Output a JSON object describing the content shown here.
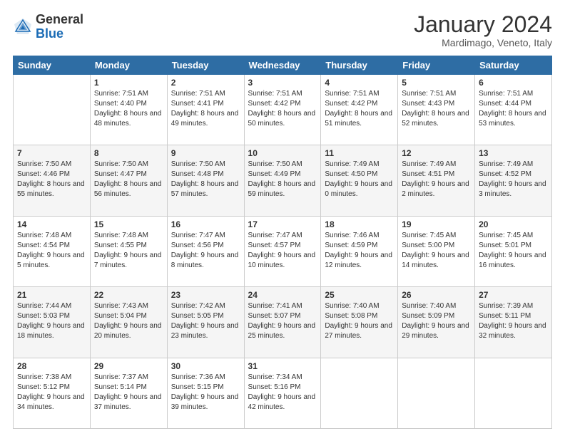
{
  "logo": {
    "general": "General",
    "blue": "Blue"
  },
  "header": {
    "month": "January 2024",
    "location": "Mardimago, Veneto, Italy"
  },
  "days_of_week": [
    "Sunday",
    "Monday",
    "Tuesday",
    "Wednesday",
    "Thursday",
    "Friday",
    "Saturday"
  ],
  "weeks": [
    [
      {
        "day": "",
        "sunrise": "",
        "sunset": "",
        "daylight": ""
      },
      {
        "day": "1",
        "sunrise": "Sunrise: 7:51 AM",
        "sunset": "Sunset: 4:40 PM",
        "daylight": "Daylight: 8 hours and 48 minutes."
      },
      {
        "day": "2",
        "sunrise": "Sunrise: 7:51 AM",
        "sunset": "Sunset: 4:41 PM",
        "daylight": "Daylight: 8 hours and 49 minutes."
      },
      {
        "day": "3",
        "sunrise": "Sunrise: 7:51 AM",
        "sunset": "Sunset: 4:42 PM",
        "daylight": "Daylight: 8 hours and 50 minutes."
      },
      {
        "day": "4",
        "sunrise": "Sunrise: 7:51 AM",
        "sunset": "Sunset: 4:42 PM",
        "daylight": "Daylight: 8 hours and 51 minutes."
      },
      {
        "day": "5",
        "sunrise": "Sunrise: 7:51 AM",
        "sunset": "Sunset: 4:43 PM",
        "daylight": "Daylight: 8 hours and 52 minutes."
      },
      {
        "day": "6",
        "sunrise": "Sunrise: 7:51 AM",
        "sunset": "Sunset: 4:44 PM",
        "daylight": "Daylight: 8 hours and 53 minutes."
      }
    ],
    [
      {
        "day": "7",
        "sunrise": "Sunrise: 7:50 AM",
        "sunset": "Sunset: 4:46 PM",
        "daylight": "Daylight: 8 hours and 55 minutes."
      },
      {
        "day": "8",
        "sunrise": "Sunrise: 7:50 AM",
        "sunset": "Sunset: 4:47 PM",
        "daylight": "Daylight: 8 hours and 56 minutes."
      },
      {
        "day": "9",
        "sunrise": "Sunrise: 7:50 AM",
        "sunset": "Sunset: 4:48 PM",
        "daylight": "Daylight: 8 hours and 57 minutes."
      },
      {
        "day": "10",
        "sunrise": "Sunrise: 7:50 AM",
        "sunset": "Sunset: 4:49 PM",
        "daylight": "Daylight: 8 hours and 59 minutes."
      },
      {
        "day": "11",
        "sunrise": "Sunrise: 7:49 AM",
        "sunset": "Sunset: 4:50 PM",
        "daylight": "Daylight: 9 hours and 0 minutes."
      },
      {
        "day": "12",
        "sunrise": "Sunrise: 7:49 AM",
        "sunset": "Sunset: 4:51 PM",
        "daylight": "Daylight: 9 hours and 2 minutes."
      },
      {
        "day": "13",
        "sunrise": "Sunrise: 7:49 AM",
        "sunset": "Sunset: 4:52 PM",
        "daylight": "Daylight: 9 hours and 3 minutes."
      }
    ],
    [
      {
        "day": "14",
        "sunrise": "Sunrise: 7:48 AM",
        "sunset": "Sunset: 4:54 PM",
        "daylight": "Daylight: 9 hours and 5 minutes."
      },
      {
        "day": "15",
        "sunrise": "Sunrise: 7:48 AM",
        "sunset": "Sunset: 4:55 PM",
        "daylight": "Daylight: 9 hours and 7 minutes."
      },
      {
        "day": "16",
        "sunrise": "Sunrise: 7:47 AM",
        "sunset": "Sunset: 4:56 PM",
        "daylight": "Daylight: 9 hours and 8 minutes."
      },
      {
        "day": "17",
        "sunrise": "Sunrise: 7:47 AM",
        "sunset": "Sunset: 4:57 PM",
        "daylight": "Daylight: 9 hours and 10 minutes."
      },
      {
        "day": "18",
        "sunrise": "Sunrise: 7:46 AM",
        "sunset": "Sunset: 4:59 PM",
        "daylight": "Daylight: 9 hours and 12 minutes."
      },
      {
        "day": "19",
        "sunrise": "Sunrise: 7:45 AM",
        "sunset": "Sunset: 5:00 PM",
        "daylight": "Daylight: 9 hours and 14 minutes."
      },
      {
        "day": "20",
        "sunrise": "Sunrise: 7:45 AM",
        "sunset": "Sunset: 5:01 PM",
        "daylight": "Daylight: 9 hours and 16 minutes."
      }
    ],
    [
      {
        "day": "21",
        "sunrise": "Sunrise: 7:44 AM",
        "sunset": "Sunset: 5:03 PM",
        "daylight": "Daylight: 9 hours and 18 minutes."
      },
      {
        "day": "22",
        "sunrise": "Sunrise: 7:43 AM",
        "sunset": "Sunset: 5:04 PM",
        "daylight": "Daylight: 9 hours and 20 minutes."
      },
      {
        "day": "23",
        "sunrise": "Sunrise: 7:42 AM",
        "sunset": "Sunset: 5:05 PM",
        "daylight": "Daylight: 9 hours and 23 minutes."
      },
      {
        "day": "24",
        "sunrise": "Sunrise: 7:41 AM",
        "sunset": "Sunset: 5:07 PM",
        "daylight": "Daylight: 9 hours and 25 minutes."
      },
      {
        "day": "25",
        "sunrise": "Sunrise: 7:40 AM",
        "sunset": "Sunset: 5:08 PM",
        "daylight": "Daylight: 9 hours and 27 minutes."
      },
      {
        "day": "26",
        "sunrise": "Sunrise: 7:40 AM",
        "sunset": "Sunset: 5:09 PM",
        "daylight": "Daylight: 9 hours and 29 minutes."
      },
      {
        "day": "27",
        "sunrise": "Sunrise: 7:39 AM",
        "sunset": "Sunset: 5:11 PM",
        "daylight": "Daylight: 9 hours and 32 minutes."
      }
    ],
    [
      {
        "day": "28",
        "sunrise": "Sunrise: 7:38 AM",
        "sunset": "Sunset: 5:12 PM",
        "daylight": "Daylight: 9 hours and 34 minutes."
      },
      {
        "day": "29",
        "sunrise": "Sunrise: 7:37 AM",
        "sunset": "Sunset: 5:14 PM",
        "daylight": "Daylight: 9 hours and 37 minutes."
      },
      {
        "day": "30",
        "sunrise": "Sunrise: 7:36 AM",
        "sunset": "Sunset: 5:15 PM",
        "daylight": "Daylight: 9 hours and 39 minutes."
      },
      {
        "day": "31",
        "sunrise": "Sunrise: 7:34 AM",
        "sunset": "Sunset: 5:16 PM",
        "daylight": "Daylight: 9 hours and 42 minutes."
      },
      {
        "day": "",
        "sunrise": "",
        "sunset": "",
        "daylight": ""
      },
      {
        "day": "",
        "sunrise": "",
        "sunset": "",
        "daylight": ""
      },
      {
        "day": "",
        "sunrise": "",
        "sunset": "",
        "daylight": ""
      }
    ]
  ]
}
